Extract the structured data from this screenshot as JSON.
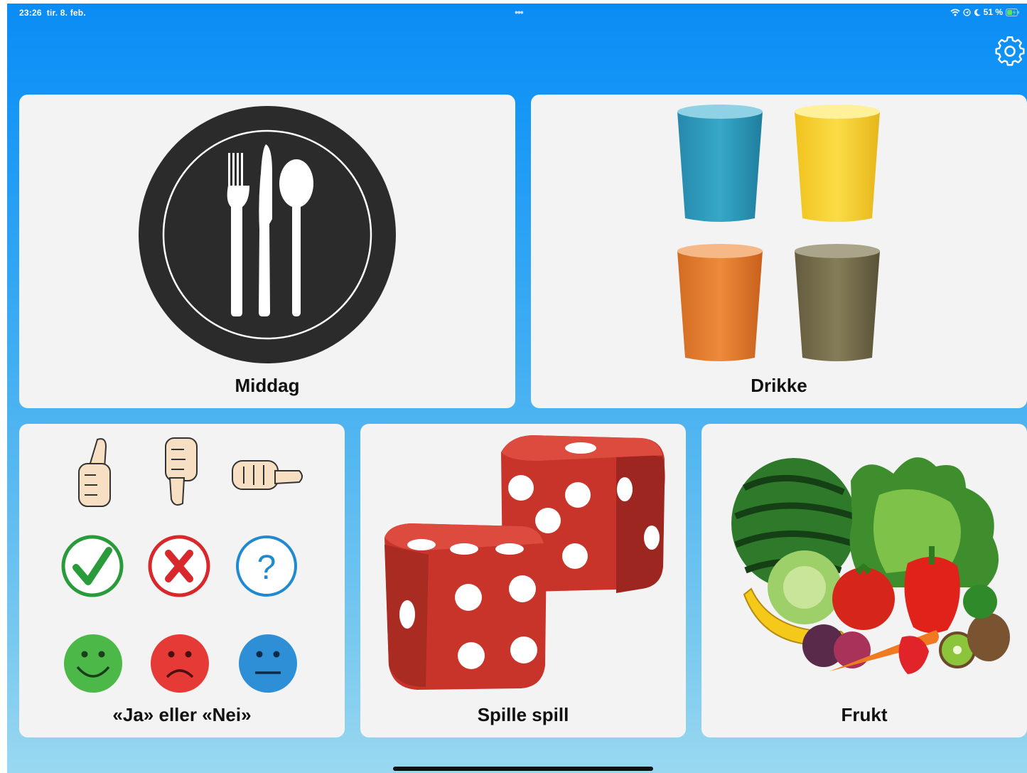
{
  "status_bar": {
    "time": "23:26",
    "date": "tir. 8. feb.",
    "battery": "51 %"
  },
  "tiles": [
    {
      "label": "Middag"
    },
    {
      "label": "Drikke"
    },
    {
      "label": "«Ja» eller «Nei»"
    },
    {
      "label": "Spille spill"
    },
    {
      "label": "Frukt"
    }
  ],
  "colors": {
    "background_top": "#0a8cf5",
    "background_bottom": "#9ad8f0",
    "tile": "#f3f3f3",
    "cup_blue": "#2f9bbc",
    "cup_yellow": "#f6d232",
    "cup_orange": "#e07a2e",
    "cup_olive": "#756e4e",
    "yes_green": "#2a9b3a",
    "no_red": "#d8282c",
    "question_blue": "#1f8ad0",
    "dice_red": "#c8342a"
  },
  "icons": [
    "settings-gear-icon",
    "wifi-icon",
    "location-icon",
    "moon-icon",
    "battery-icon",
    "multitasking-dots-icon"
  ]
}
